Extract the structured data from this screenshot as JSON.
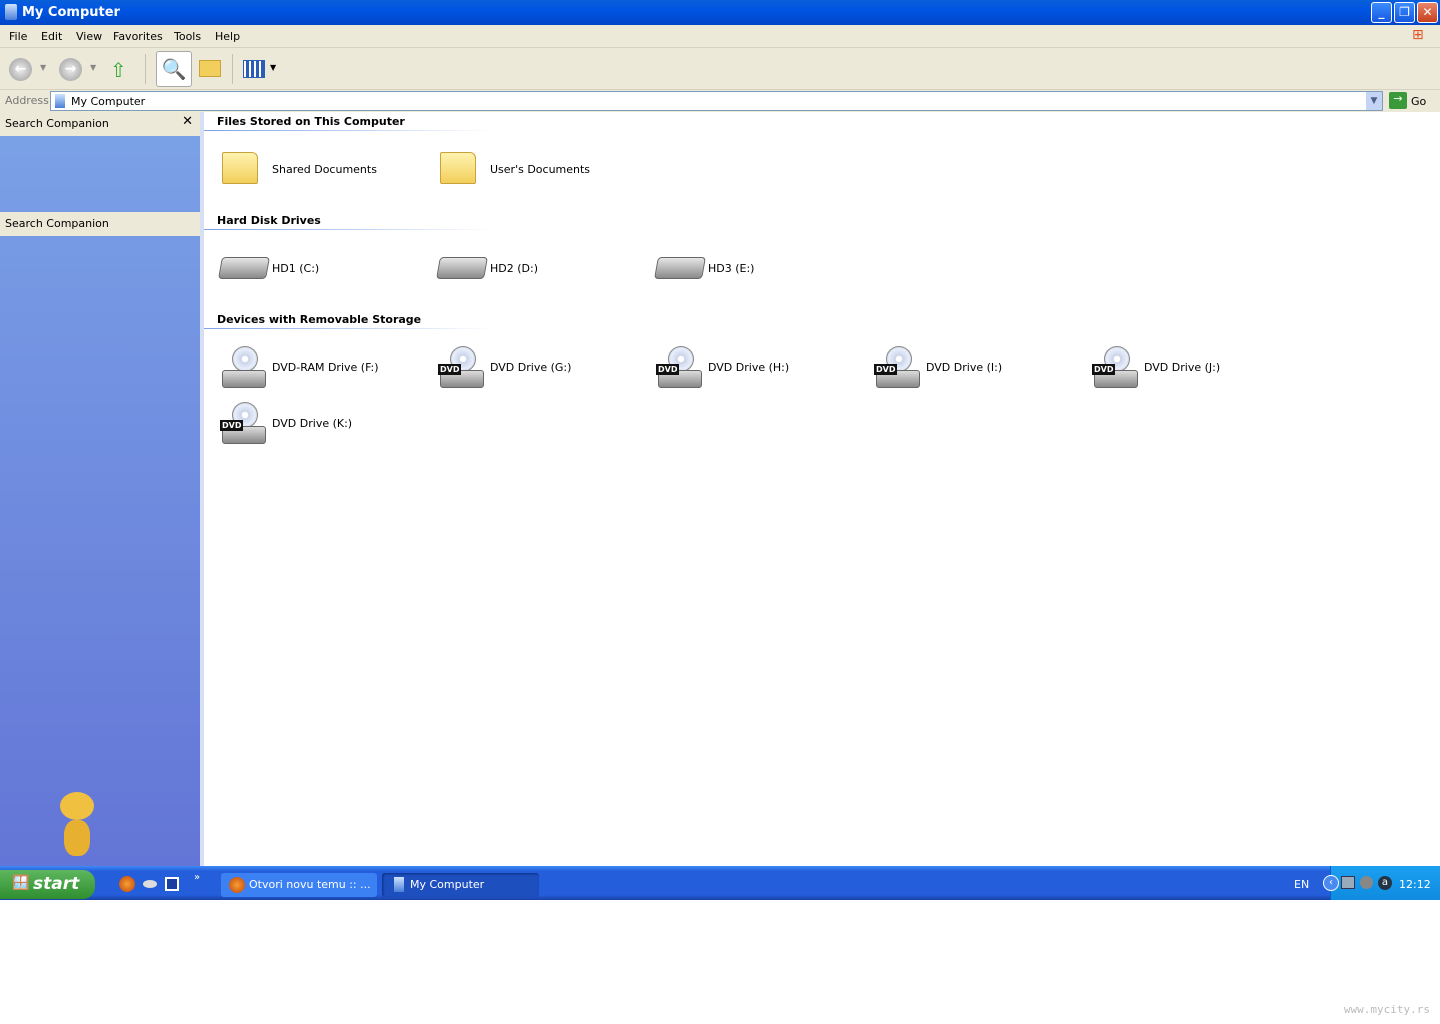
{
  "window": {
    "title": "My Computer"
  },
  "menu": [
    "File",
    "Edit",
    "View",
    "Favorites",
    "Tools",
    "Help"
  ],
  "address": {
    "label": "Address",
    "value": "My Computer",
    "go": "Go"
  },
  "left_pane": {
    "header1": "Search Companion",
    "header2": "Search Companion"
  },
  "sections": [
    {
      "title": "Files Stored on This Computer",
      "items": [
        "Shared Documents",
        "User's Documents"
      ]
    },
    {
      "title": "Hard Disk Drives",
      "items": [
        "HD1 (C:)",
        "HD2 (D:)",
        "HD3 (E:)"
      ]
    },
    {
      "title": "Devices with Removable Storage",
      "items": [
        "DVD-RAM Drive (F:)",
        "DVD Drive (G:)",
        "DVD Drive (H:)",
        "DVD Drive (I:)",
        "DVD Drive (J:)",
        "DVD Drive (K:)"
      ]
    }
  ],
  "dvd_tag": "DVD",
  "taskbar": {
    "start": "start",
    "tasks": [
      "Otvori novu temu :: ...",
      "My Computer"
    ],
    "lang": "EN",
    "clock": "12:12"
  },
  "watermark": "www.mycity.rs"
}
